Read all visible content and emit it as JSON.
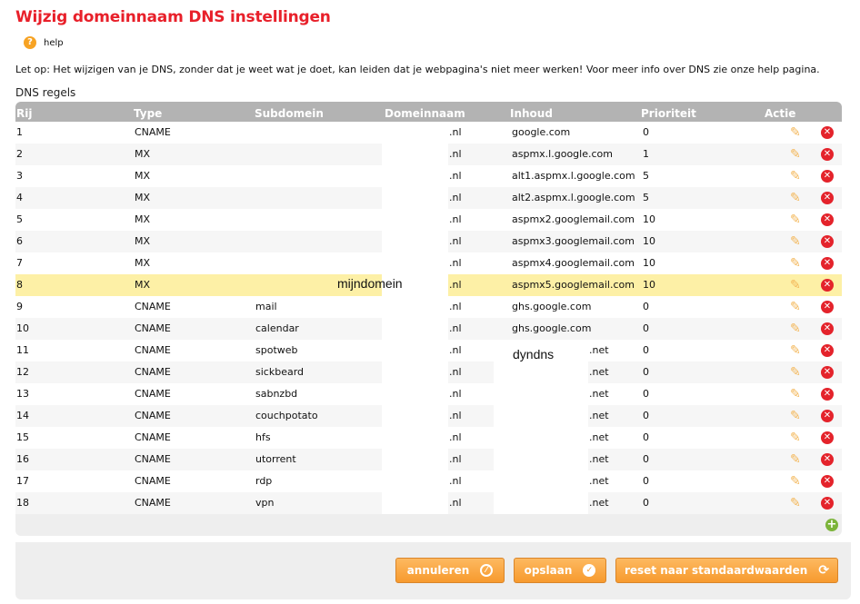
{
  "title": "Wijzig domeinnaam DNS instellingen",
  "help": "help",
  "warning": "Let op: Het wijzigen van je DNS, zonder dat je weet wat je doet, kan leiden dat je webpagina's niet meer werken! Voor meer info over DNS zie onze help pagina.",
  "section": "DNS regels",
  "columns": [
    "Rij",
    "Type",
    "Subdomein",
    "Domeinnaam",
    "Inhoud",
    "Prioriteit",
    "Actie"
  ],
  "masks": {
    "domain": "mijndomein",
    "content": "dyndns"
  },
  "rows": [
    {
      "n": "1",
      "type": "CNAME",
      "sub": "",
      "tld": ".nl",
      "content": "google.com",
      "ctld": "",
      "prio": "0"
    },
    {
      "n": "2",
      "type": "MX",
      "sub": "",
      "tld": ".nl",
      "content": "aspmx.l.google.com",
      "ctld": "",
      "prio": "1"
    },
    {
      "n": "3",
      "type": "MX",
      "sub": "",
      "tld": ".nl",
      "content": "alt1.aspmx.l.google.com",
      "ctld": "",
      "prio": "5"
    },
    {
      "n": "4",
      "type": "MX",
      "sub": "",
      "tld": ".nl",
      "content": "alt2.aspmx.l.google.com",
      "ctld": "",
      "prio": "5"
    },
    {
      "n": "5",
      "type": "MX",
      "sub": "",
      "tld": ".nl",
      "content": "aspmx2.googlemail.com",
      "ctld": "",
      "prio": "10"
    },
    {
      "n": "6",
      "type": "MX",
      "sub": "",
      "tld": ".nl",
      "content": "aspmx3.googlemail.com",
      "ctld": "",
      "prio": "10"
    },
    {
      "n": "7",
      "type": "MX",
      "sub": "",
      "tld": ".nl",
      "content": "aspmx4.googlemail.com",
      "ctld": "",
      "prio": "10"
    },
    {
      "n": "8",
      "type": "MX",
      "sub": "",
      "tld": ".nl",
      "content": "aspmx5.googlemail.com",
      "ctld": "",
      "prio": "10",
      "selected": true
    },
    {
      "n": "9",
      "type": "CNAME",
      "sub": "mail",
      "tld": ".nl",
      "content": "ghs.google.com",
      "ctld": "",
      "prio": "0"
    },
    {
      "n": "10",
      "type": "CNAME",
      "sub": "calendar",
      "tld": ".nl",
      "content": "ghs.google.com",
      "ctld": "",
      "prio": "0"
    },
    {
      "n": "11",
      "type": "CNAME",
      "sub": "spotweb",
      "tld": ".nl",
      "content": "",
      "ctld": ".net",
      "prio": "0"
    },
    {
      "n": "12",
      "type": "CNAME",
      "sub": "sickbeard",
      "tld": ".nl",
      "content": "",
      "ctld": ".net",
      "prio": "0"
    },
    {
      "n": "13",
      "type": "CNAME",
      "sub": "sabnzbd",
      "tld": ".nl",
      "content": "",
      "ctld": ".net",
      "prio": "0"
    },
    {
      "n": "14",
      "type": "CNAME",
      "sub": "couchpotato",
      "tld": ".nl",
      "content": "",
      "ctld": ".net",
      "prio": "0"
    },
    {
      "n": "15",
      "type": "CNAME",
      "sub": "hfs",
      "tld": ".nl",
      "content": "",
      "ctld": ".net",
      "prio": "0"
    },
    {
      "n": "16",
      "type": "CNAME",
      "sub": "utorrent",
      "tld": ".nl",
      "content": "",
      "ctld": ".net",
      "prio": "0"
    },
    {
      "n": "17",
      "type": "CNAME",
      "sub": "rdp",
      "tld": ".nl",
      "content": "",
      "ctld": ".net",
      "prio": "0"
    },
    {
      "n": "18",
      "type": "CNAME",
      "sub": "vpn",
      "tld": ".nl",
      "content": "",
      "ctld": ".net",
      "prio": "0"
    }
  ],
  "buttons": {
    "cancel": "annuleren",
    "save": "opslaan",
    "reset": "reset naar standaardwaarden"
  },
  "colors": {
    "title": "#e8202a",
    "accent": "#f79a2e",
    "selected": "#fdf0a6"
  }
}
